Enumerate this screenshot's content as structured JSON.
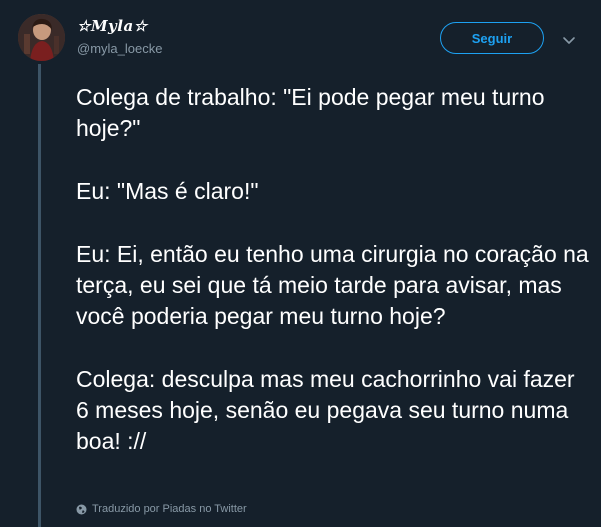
{
  "user": {
    "display_name": "☆𝑴𝒚𝒍𝒂☆",
    "handle": "@myla_loecke"
  },
  "follow_button": {
    "label": "Seguir"
  },
  "tweet": {
    "paragraphs": [
      "Colega de trabalho: \"Ei pode pegar meu turno hoje?\"",
      "Eu: \"Mas é claro!\"",
      "Eu: Ei, então eu tenho uma cirurgia no coração na terça, eu sei que tá meio tarde para avisar, mas você poderia pegar meu turno hoje?",
      "Colega: desculpa mas meu cachorrinho vai fazer 6 meses hoje, senão eu pegava seu turno numa boa! ://"
    ]
  },
  "translation_note": "Traduzido por Piadas no Twitter",
  "icons": {
    "menu": "chevron-down-icon",
    "translation": "globe-icon"
  },
  "colors": {
    "background": "#15202b",
    "accent": "#1da1f2",
    "secondary_text": "#8899a6",
    "thread_line": "#3d5466"
  }
}
